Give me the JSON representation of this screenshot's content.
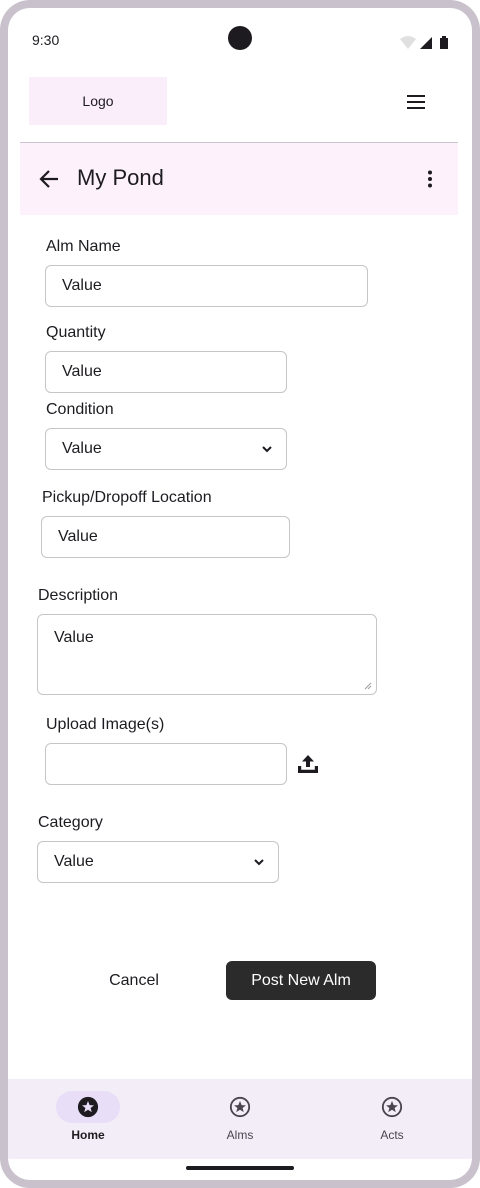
{
  "status_bar": {
    "time": "9:30"
  },
  "header": {
    "logo_text": "Logo",
    "menu_icon": "hamburger-menu-icon"
  },
  "app_bar": {
    "title": "My Pond",
    "back_icon": "arrow-back-icon",
    "more_icon": "more-vert-icon"
  },
  "form": {
    "alm_name": {
      "label": "Alm Name",
      "value": "Value"
    },
    "quantity": {
      "label": "Quantity",
      "value": "Value"
    },
    "condition": {
      "label": "Condition",
      "value": "Value"
    },
    "location": {
      "label": "Pickup/Dropoff Location",
      "value": "Value"
    },
    "description": {
      "label": "Description",
      "value": "Value"
    },
    "upload": {
      "label": "Upload Image(s)",
      "value": "",
      "icon": "upload-icon"
    },
    "category": {
      "label": "Category",
      "value": "Value"
    }
  },
  "actions": {
    "cancel_label": "Cancel",
    "post_label": "Post New Alm"
  },
  "bottom_nav": {
    "items": [
      {
        "label": "Home",
        "icon": "star-circle-icon",
        "active": true
      },
      {
        "label": "Alms",
        "icon": "star-circle-icon",
        "active": false
      },
      {
        "label": "Acts",
        "icon": "star-circle-icon",
        "active": false
      }
    ]
  },
  "colors": {
    "app_bar_bg": "#fdf2fc",
    "primary_button": "#2b2b2b",
    "nav_bg": "#f3edf7",
    "nav_active_pill": "#e8def8"
  }
}
